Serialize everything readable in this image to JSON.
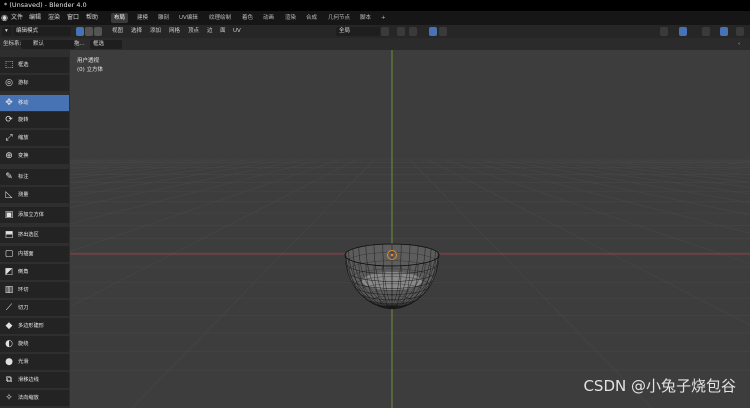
{
  "window": {
    "title": "* (Unsaved) - Blender 4.0"
  },
  "menubar": {
    "items": [
      "文件",
      "编辑",
      "渲染",
      "窗口",
      "帮助"
    ],
    "workspaces": [
      "布局",
      "建模",
      "雕刻",
      "UV编辑",
      "纹理绘制",
      "着色",
      "动画",
      "渲染",
      "合成",
      "几何节点",
      "脚本"
    ],
    "active_workspace": "布局",
    "add_tab": "+"
  },
  "header": {
    "mode": "编辑模式",
    "menus": [
      "视图",
      "选择",
      "添加",
      "网格",
      "顶点",
      "边",
      "面",
      "UV"
    ],
    "transform_orientation": "全局"
  },
  "header2": {
    "coord_label": "坐标系:",
    "coord_value": "默认",
    "drag_label": "拖...",
    "select_value": "框选"
  },
  "tools": [
    {
      "label": "框选",
      "icon": "select-box-icon",
      "glyph": "⬚"
    },
    {
      "label": "游标",
      "icon": "cursor-icon",
      "glyph": "◎"
    },
    {
      "label": "移动",
      "icon": "move-icon",
      "glyph": "✥",
      "active": true
    },
    {
      "label": "旋转",
      "icon": "rotate-icon",
      "glyph": "⟳"
    },
    {
      "label": "缩放",
      "icon": "scale-icon",
      "glyph": "⤢"
    },
    {
      "label": "变换",
      "icon": "transform-icon",
      "glyph": "⊕"
    },
    {
      "label": "标注",
      "icon": "annotate-icon",
      "glyph": "✎"
    },
    {
      "label": "测量",
      "icon": "measure-icon",
      "glyph": "◺"
    },
    {
      "label": "添加立方体",
      "icon": "add-cube-icon",
      "glyph": "▣"
    },
    {
      "label": "挤出选区",
      "icon": "extrude-icon",
      "glyph": "⬒"
    },
    {
      "label": "内插面",
      "icon": "inset-faces-icon",
      "glyph": "▢"
    },
    {
      "label": "倒角",
      "icon": "bevel-icon",
      "glyph": "◩"
    },
    {
      "label": "环切",
      "icon": "loop-cut-icon",
      "glyph": "▥"
    },
    {
      "label": "切刀",
      "icon": "knife-icon",
      "glyph": "⟋"
    },
    {
      "label": "多边形建形",
      "icon": "poly-build-icon",
      "glyph": "◆"
    },
    {
      "label": "旋绕",
      "icon": "spin-icon",
      "glyph": "◐"
    },
    {
      "label": "光滑",
      "icon": "smooth-icon",
      "glyph": "●"
    },
    {
      "label": "滑移边线",
      "icon": "edge-slide-icon",
      "glyph": "⧉"
    },
    {
      "label": "法向缩放",
      "icon": "shrink-fatten-icon",
      "glyph": "✧"
    }
  ],
  "viewport": {
    "view_name": "用户透视",
    "object_name": "(0) 立方体"
  },
  "watermark": "CSDN @小兔子烧包谷",
  "colors": {
    "accent": "#4772b3",
    "x_axis": "#b0444e",
    "y_axis": "#7fa33a"
  }
}
